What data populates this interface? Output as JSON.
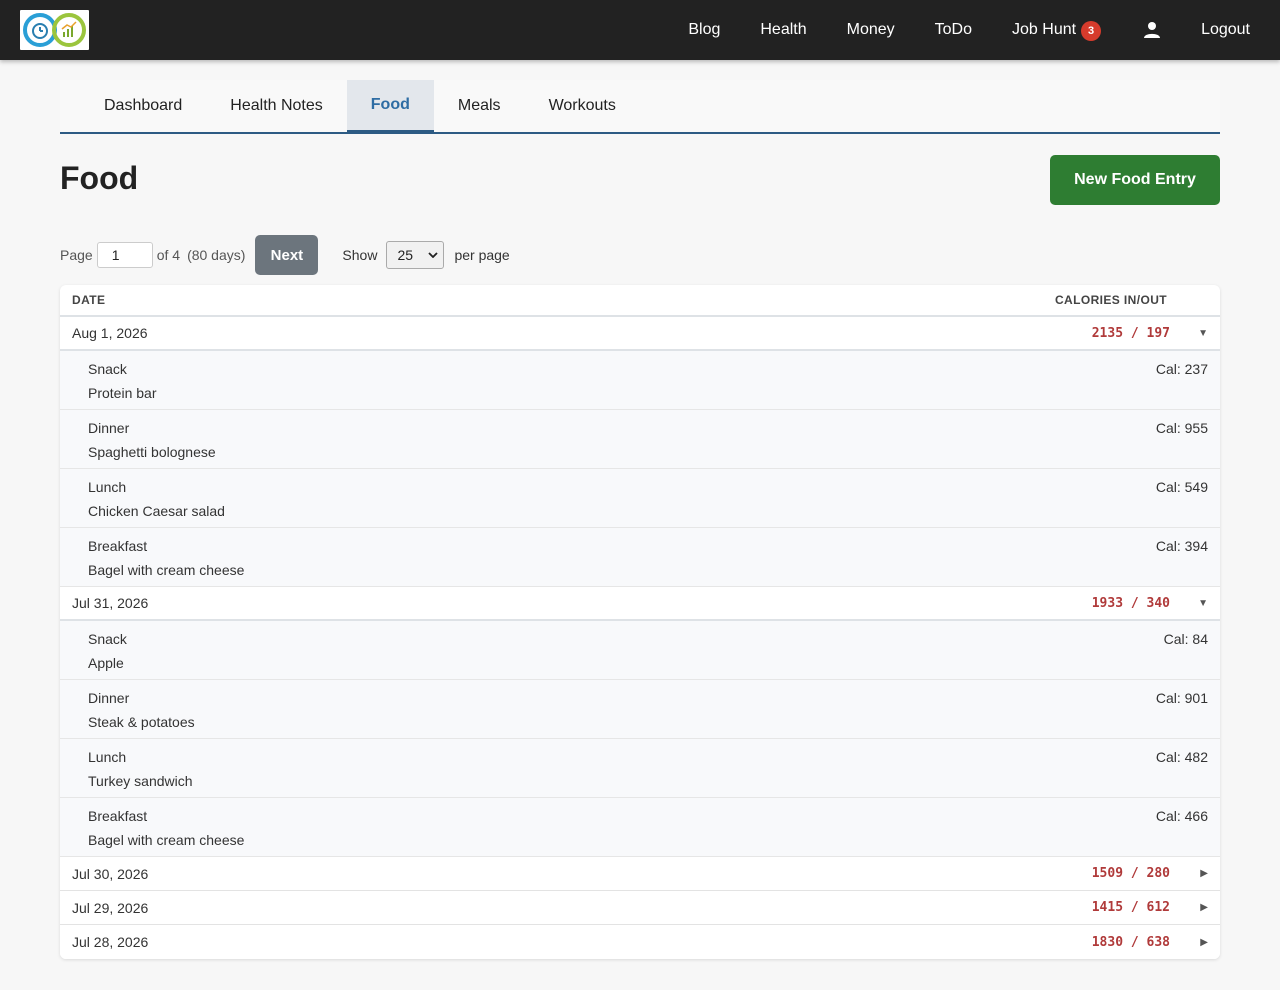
{
  "nav": {
    "links": [
      "Blog",
      "Health",
      "Money",
      "ToDo"
    ],
    "job_hunt": "Job Hunt",
    "job_hunt_badge": "3",
    "logout": "Logout",
    "user_icon": "user-icon",
    "logo_icon": "health-money-logo"
  },
  "tabs": [
    "Dashboard",
    "Health Notes",
    "Food",
    "Meals",
    "Workouts"
  ],
  "active_tab": "Food",
  "page": {
    "title": "Food",
    "new_button": "New Food Entry"
  },
  "pagination": {
    "page_label": "Page",
    "page_value": "1",
    "of_label": "of 4",
    "days_label": "(80 days)",
    "next": "Next",
    "show_label": "Show",
    "per_page_value": "25",
    "per_page_label": "per page"
  },
  "table": {
    "col_date": "DATE",
    "col_calories": "CALORIES IN/OUT",
    "days": [
      {
        "date": "Aug 1, 2026",
        "calories": "2135 / 197",
        "toggle": "▼",
        "meals": [
          {
            "type": "Snack",
            "desc": "Protein bar",
            "cal": "Cal: 237"
          },
          {
            "type": "Dinner",
            "desc": "Spaghetti bolognese",
            "cal": "Cal: 955"
          },
          {
            "type": "Lunch",
            "desc": "Chicken Caesar salad",
            "cal": "Cal: 549"
          },
          {
            "type": "Breakfast",
            "desc": "Bagel with cream cheese",
            "cal": "Cal: 394"
          }
        ]
      },
      {
        "date": "Jul 31, 2026",
        "calories": "1933 / 340",
        "toggle": "▼",
        "meals": [
          {
            "type": "Snack",
            "desc": "Apple",
            "cal": "Cal: 84"
          },
          {
            "type": "Dinner",
            "desc": "Steak & potatoes",
            "cal": "Cal: 901"
          },
          {
            "type": "Lunch",
            "desc": "Turkey sandwich",
            "cal": "Cal: 482"
          },
          {
            "type": "Breakfast",
            "desc": "Bagel with cream cheese",
            "cal": "Cal: 466"
          }
        ]
      },
      {
        "date": "Jul 30, 2026",
        "calories": "1509 / 280",
        "toggle": "▶"
      },
      {
        "date": "Jul 29, 2026",
        "calories": "1415 / 612",
        "toggle": "▶"
      },
      {
        "date": "Jul 28, 2026",
        "calories": "1830 / 638",
        "toggle": "▶"
      }
    ]
  },
  "colors": {
    "navbar": "#222222",
    "accent": "#2d5b84",
    "new_button": "#2e7d32",
    "calories": "#b03a3a",
    "badge": "#d63b2c"
  }
}
